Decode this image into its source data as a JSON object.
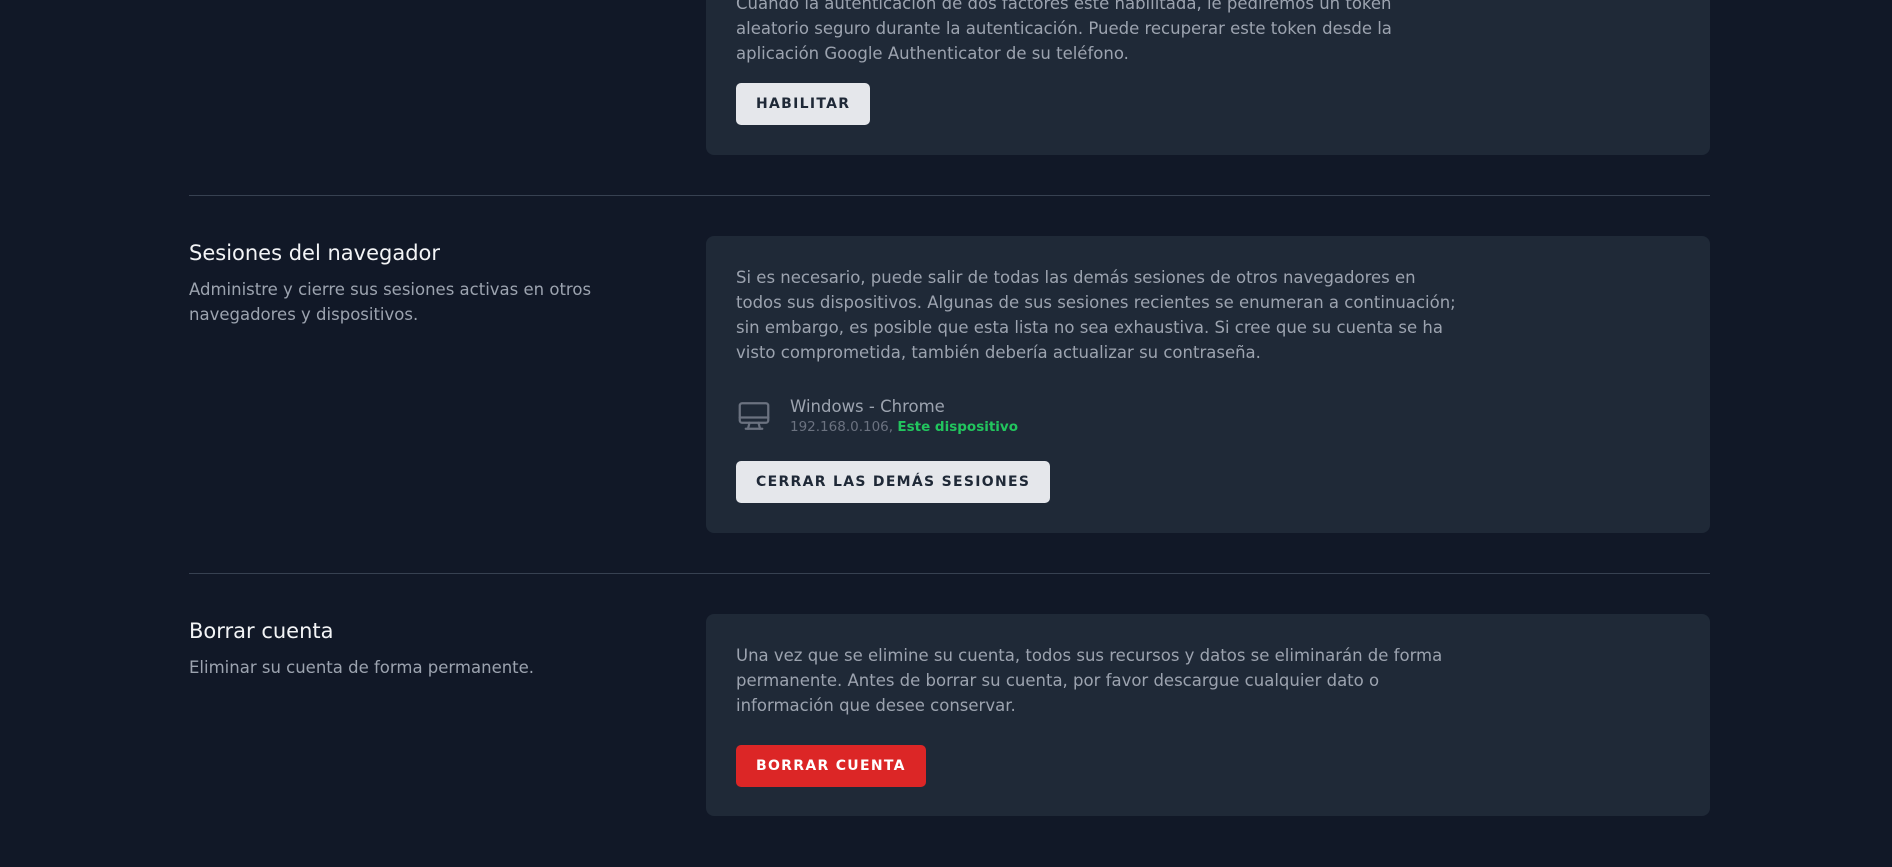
{
  "two_factor": {
    "description": "Cuando la autenticación de dos factores esté habilitada, le pediremos un token aleatorio seguro durante la autenticación. Puede recuperar este token desde la aplicación Google Authenticator de su teléfono.",
    "enable_button": "Habilitar"
  },
  "browser_sessions": {
    "title": "Sesiones del navegador",
    "subtitle": "Administre y cierre sus sesiones activas en otros navegadores y dispositivos.",
    "description": "Si es necesario, puede salir de todas las demás sesiones de otros navegadores en todos sus dispositivos. Algunas de sus sesiones recientes se enumeran a continuación; sin embargo, es posible que esta lista no sea exhaustiva. Si cree que su cuenta se ha visto comprometida, también debería actualizar su contraseña.",
    "session": {
      "name": "Windows - Chrome",
      "ip": "192.168.0.106,",
      "current_label": "Este dispositivo",
      "icon": "desktop-icon"
    },
    "logout_button": "Cerrar las demás sesiones"
  },
  "delete_account": {
    "title": "Borrar cuenta",
    "subtitle": "Eliminar su cuenta de forma permanente.",
    "description": "Una vez que se elimine su cuenta, todos sus recursos y datos se eliminarán de forma permanente. Antes de borrar su cuenta, por favor descargue cualquier dato o información que desee conservar.",
    "delete_button": "Borrar cuenta"
  },
  "colors": {
    "page_background": "#111827",
    "card_background": "#1f2937",
    "danger": "#dc2626",
    "success": "#22c55e"
  }
}
